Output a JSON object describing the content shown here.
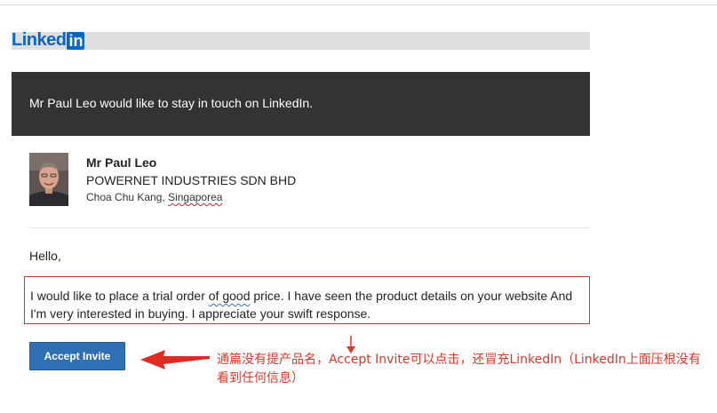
{
  "brand": {
    "logo_linked": "Linked",
    "logo_in": "in"
  },
  "header": {
    "text": "Mr Paul Leo would like to stay in touch on LinkedIn."
  },
  "sender": {
    "name": "Mr Paul Leo",
    "company": "POWERNET INDUSTRIES SDN BHD",
    "location_city": "Choa Chu Kang, ",
    "location_country": "Singaporea"
  },
  "message": {
    "greeting": "Hello,",
    "body_before": "I would like to place a trial order ",
    "body_underlined": "of good",
    "body_after": " price. I have seen the product details on your website And I'm very interested in buying. I appreciate your swift response."
  },
  "button": {
    "label": "Accept Invite"
  },
  "annotation": {
    "text": "通篇没有提产品名，Accept Invite可以点击，还冒充LinkedIn（LinkedIn上面压根没有看到任何信息）",
    "color": "#d9382a"
  },
  "colors": {
    "brand": "#0a66c2",
    "header_bg": "#333333",
    "button_bg": "#2f6fb3",
    "highlight_border": "#cc3333"
  }
}
